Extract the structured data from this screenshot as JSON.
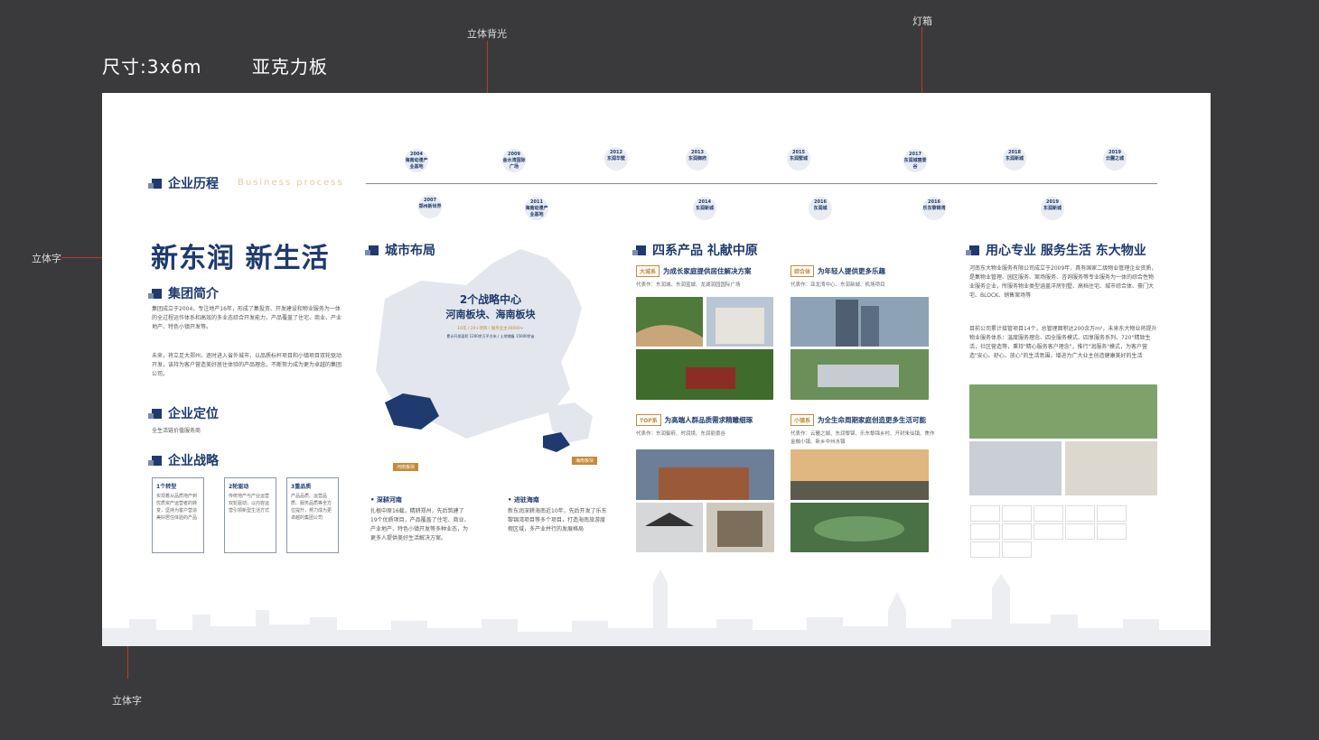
{
  "header": {
    "size_label": "尺寸:3x6m",
    "material_label": "亚克力板"
  },
  "annotations": {
    "backlight": "立体背光",
    "lightbox": "灯箱",
    "text_left": "立体字",
    "text_bottom": "立体字"
  },
  "history": {
    "title": "企业历程",
    "subtitle": "Business process",
    "milestones_top": [
      {
        "year": "2004",
        "name": "海南动漫产业基地"
      },
      {
        "year": "2009",
        "name": "金水湾国际广场"
      },
      {
        "year": "2012",
        "name": "东润华墅"
      },
      {
        "year": "2013",
        "name": "东润御府"
      },
      {
        "year": "2015",
        "name": "东润墅城"
      },
      {
        "year": "2017",
        "name": "东润城丽景谷"
      },
      {
        "year": "2018",
        "name": "东润新城"
      },
      {
        "year": "2019",
        "name": "云麓之城"
      }
    ],
    "milestones_bottom": [
      {
        "year": "2007",
        "name": "郑州新世界"
      },
      {
        "year": "2011",
        "name": "海南动漫产业基地"
      },
      {
        "year": "2014",
        "name": "东润新城"
      },
      {
        "year": "2016",
        "name": "东润城"
      },
      {
        "year": "2016",
        "name": "乐东黎锦湾"
      },
      {
        "year": "2019",
        "name": "东润新城"
      }
    ]
  },
  "slogan": "新东润 新生活",
  "intro": {
    "title": "集团简介",
    "p1": "集团成立于2004，专注地产16年，形成了集投资、开发建设和物业服务为一体的全过程运作体系和高效的多业态综合开发能力，产品覆盖了住宅、商业、产业地产、特色小镇开发等。",
    "p2": "未来，将立足大郑州，逐时进入省外城市，以品质标杆项目和小镇项目双轮驱动开发，该持为客户营造美好居住体验的产品理念，不断努力成为更为卓越的集团公司。"
  },
  "position": {
    "title": "企业定位",
    "text": "全生活链价值服务商"
  },
  "strategy": {
    "title": "企业战略",
    "items": [
      {
        "num": "1",
        "name": "个转型",
        "text": "实现着从品质地产到优质资产运营者的转变，坚持为客户营造美好居住体验的产品"
      },
      {
        "num": "2",
        "name": "轮驱动",
        "text": "传统地产与产业运营双轮驱动，以内容运营引领新型生活方式"
      },
      {
        "num": "3",
        "name": "重品质",
        "text": "产品品质、运营品质、服务品质等全方位提升，努力成为更卓越的集团公司"
      }
    ]
  },
  "city": {
    "title": "城市布局",
    "map_title": "2个战略中心",
    "map_sub": "河南板块、海南板块",
    "stat1": "16年 / 20+项目 / 服务业主30000+",
    "stat2": "累计开发面积 1200余万平方米 / 土地储备 15000余亩",
    "henan_tag": "河南板块",
    "hainan_tag": "海南板块",
    "henan_title": "• 深耕河南",
    "henan_text": "扎根中原16载，精耕郑州，先后筑建了19个优质项目，产品覆盖了住宅、商业、产业地产、特色小镇开发等多种业态，为更多人提供美好生活解决方案。",
    "hainan_title": "• 进驻海南",
    "hainan_text": "新东润深耕海南近10年，先后开发了乐东黎锦湾项目等多个项目，打造海南旅游度假区域，多产业并行的发展格局"
  },
  "products": {
    "title": "四系产品 礼献中原",
    "items": [
      {
        "tag": "大城系",
        "title": "为成长家庭提供居住解决方案",
        "sub": "代表作：东润城、东润蓝城、龙湖润园国际广场"
      },
      {
        "tag": "综合体",
        "title": "为年轻人提供更多乐趣",
        "sub": "代表作：亚龙湾中心、东润新城、机场项目"
      },
      {
        "tag": "TOP系",
        "title": "为高端人群品质需求精雕细琢",
        "sub": "代表作：东润御府、时润境、东润丽景谷"
      },
      {
        "tag": "小镇系",
        "title": "为全生命周期家庭创造更多生活可能",
        "sub": "代表作：云麓之城、东润黎锦、乐东黎锦乡村、开封朱仙镇、焦作金融小镇、新乡中州水镇"
      }
    ]
  },
  "service": {
    "title": "用心专业 服务生活 东大物业",
    "p1": "河南东大物业服务有限公司成立于2009年，具有国家二级物业管理企业资质，是集物业管理、园区服务、案场服务、咨询服务等专业服务为一体的综合性物业服务企业，所服务物业类型涵盖洋房别墅、高档住宅、城市综合体、豪门大宅、BLOCK、销售案场等",
    "p2": "目前公司累计接管项目14个，总管理面积达200余万m²，未来东大物业将提升物业服务体系：温度服务理念、四全服务模式、四享服务系列、720°精致生活，社区营造等，秉持\"精心服务客户理念\"，推行\"润服务\"模式，为客户营造\"安心、舒心、放心\"的生活氛围，增进为广大业主创造健康美好的生活"
  },
  "colors": {
    "navy": "#1e3a6e",
    "board": "#ffffff",
    "background": "#3a3a3c",
    "accent_red": "#c0392b",
    "gold": "#c58a3b"
  }
}
